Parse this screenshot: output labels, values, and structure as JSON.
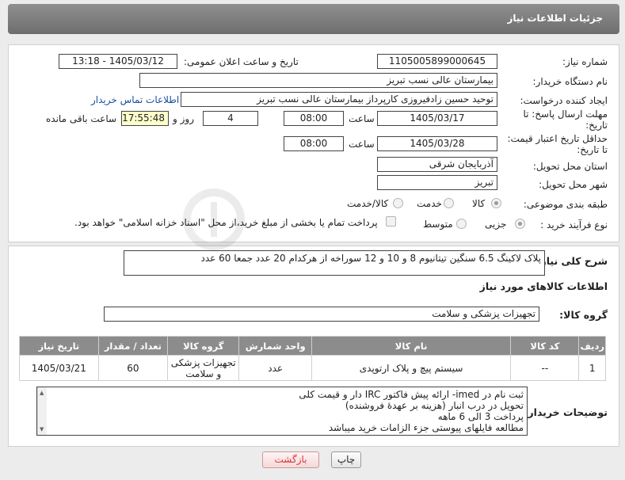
{
  "header": {
    "title": "جزئیات اطلاعات نیاز"
  },
  "form": {
    "need_number_label": "شماره نیاز:",
    "need_number": "1105005899000645",
    "announce_label": "تاریخ و ساعت اعلان عمومی:",
    "announce_value": "1405/03/12 - 13:18",
    "buyer_org_label": "نام دستگاه خریدار:",
    "buyer_org": "بیمارستان عالی نسب تبریز",
    "creator_label": "ایجاد کننده درخواست:",
    "creator": "توحید حسین زادفیروزی کارپرداز بیمارستان عالی نسب تبریز",
    "contact_link": "اطلاعات تماس خریدار",
    "reply_deadline_label_1": "مهلت ارسال پاسخ: تا",
    "reply_deadline_label_2": "تاریخ:",
    "reply_date": "1405/03/17",
    "time_label": "ساعت",
    "reply_time": "08:00",
    "days_value": "4",
    "days_label": "روز و",
    "remaining_time": "17:55:48",
    "remaining_label": "ساعت باقی مانده",
    "price_valid_label_1": "حداقل تاریخ اعتبار قیمت:",
    "price_valid_label_2": "تا تاریخ:",
    "price_valid_date": "1405/03/28",
    "price_valid_time": "08:00",
    "province_label": "استان محل تحویل:",
    "province": "آذربایجان شرقی",
    "city_label": "شهر محل تحویل:",
    "city": "تبریز",
    "category_label": "طبقه بندی موضوعی:",
    "category_options": [
      "کالا",
      "خدمت",
      "کالا/خدمت"
    ],
    "process_label": "نوع فرآیند خرید :",
    "process_options": [
      "جزیی",
      "متوسط"
    ],
    "payment_note": "پرداخت تمام یا بخشی از مبلغ خرید،از محل \"اسناد خزانه اسلامی\" خواهد بود."
  },
  "description": {
    "label": "شرح کلی نیاز:",
    "text": "پلاک لاکینگ 6.5 سنگین تیتانیوم 8 و 10 و 12 سوراخه از هرکدام 20 عدد جمعا 60 عدد"
  },
  "goods": {
    "section_title": "اطلاعات کالاهای مورد نیاز",
    "group_label": "گروه کالا:",
    "group_value": "تجهیزات پزشکی و سلامت",
    "columns": [
      "ردیف",
      "کد کالا",
      "نام کالا",
      "واحد شمارش",
      "گروه کالا",
      "تعداد / مقدار",
      "تاریخ نیاز"
    ],
    "rows": [
      [
        "1",
        "--",
        "سیستم پیچ و پلاک ارتوپدی",
        "عدد",
        "تجهیزات پزشکی و سلامت",
        "60",
        "1405/03/21"
      ]
    ]
  },
  "buyer_notes": {
    "label": "توضیحات خریدار:",
    "lines": [
      "ثبت نام در imed- ارائه پیش فاکتور IRC دار و قیمت کلی",
      "تحویل در درب انبار (هزینه بر عهدهٔ فروشنده)",
      "پرداخت  3 الی 6 ماهه",
      "مطالعه فایلهای پیوستی جزء الزامات خرید میباشد"
    ]
  },
  "buttons": {
    "print": "چاپ",
    "back": "بازگشت"
  },
  "colors": {
    "header_bg": "#7a7a7a",
    "table_head": "#8c8c8c",
    "link": "#1a4fa0"
  }
}
